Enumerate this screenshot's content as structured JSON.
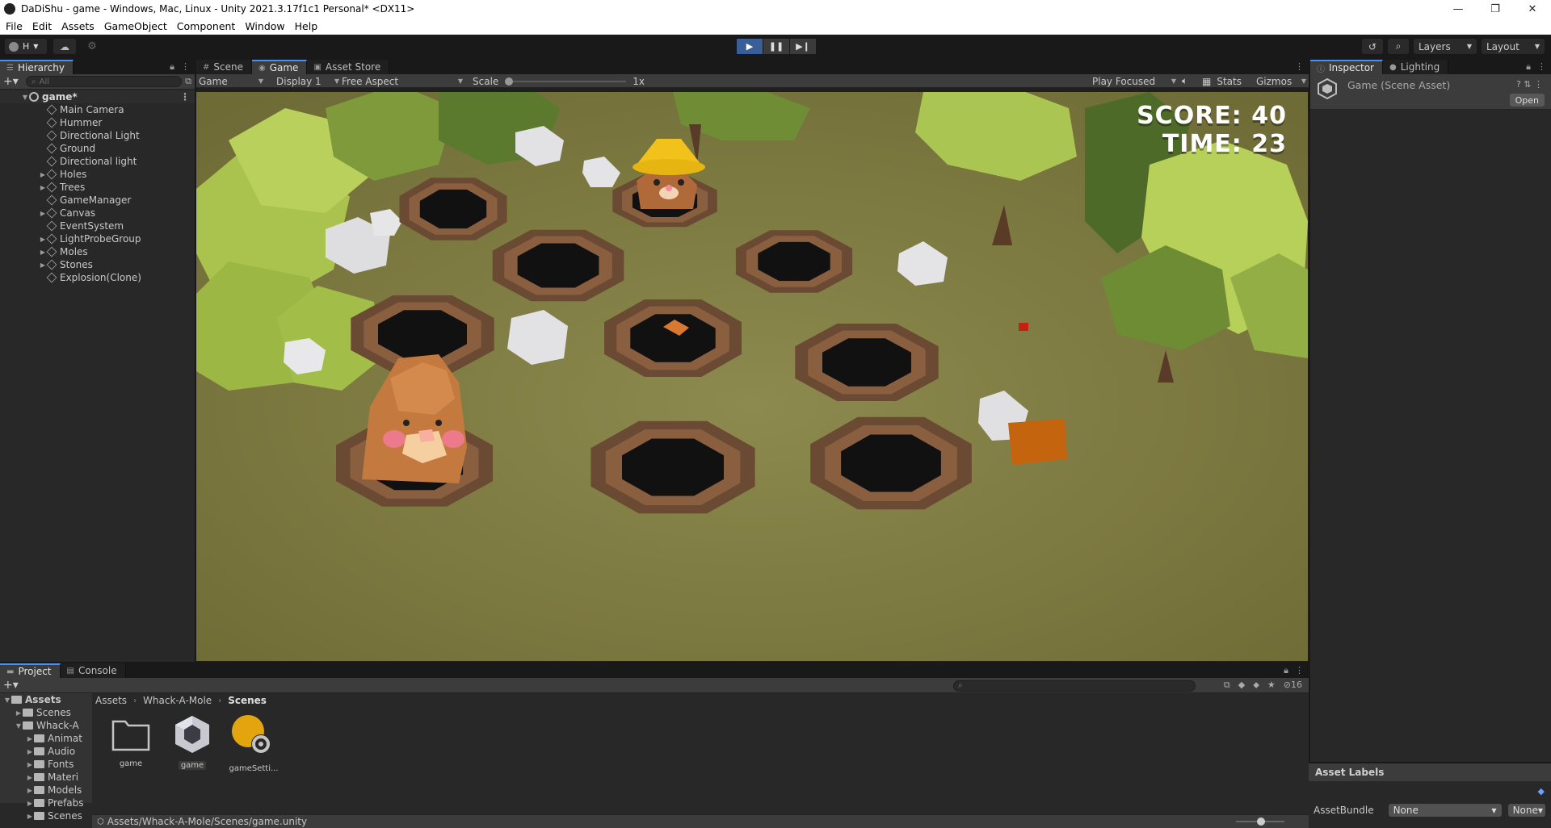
{
  "window": {
    "title": "DaDiShu - game - Windows, Mac, Linux - Unity 2021.3.17f1c1 Personal* <DX11>",
    "controls": [
      "—",
      "❐",
      "✕"
    ]
  },
  "menu": [
    "File",
    "Edit",
    "Assets",
    "GameObject",
    "Component",
    "Window",
    "Help"
  ],
  "toolbar": {
    "account_label": "H",
    "layers_label": "Layers",
    "layout_label": "Layout"
  },
  "hierarchy": {
    "tab_label": "Hierarchy",
    "search_placeholder": "All",
    "scene_name": "game*",
    "items": [
      {
        "label": "Main Camera",
        "expandable": false
      },
      {
        "label": "Hummer",
        "expandable": false
      },
      {
        "label": "Directional Light",
        "expandable": false
      },
      {
        "label": "Ground",
        "expandable": false
      },
      {
        "label": "Directional light",
        "expandable": false
      },
      {
        "label": "Holes",
        "expandable": true
      },
      {
        "label": "Trees",
        "expandable": true
      },
      {
        "label": "GameManager",
        "expandable": false
      },
      {
        "label": "Canvas",
        "expandable": true
      },
      {
        "label": "EventSystem",
        "expandable": false
      },
      {
        "label": "LightProbeGroup",
        "expandable": true
      },
      {
        "label": "Moles",
        "expandable": true
      },
      {
        "label": "Stones",
        "expandable": true
      },
      {
        "label": "Explosion(Clone)",
        "expandable": false
      }
    ]
  },
  "center_tabs": [
    {
      "label": "Scene",
      "icon": "grid-icon",
      "active": false
    },
    {
      "label": "Game",
      "icon": "gamepad-icon",
      "active": true
    },
    {
      "label": "Asset Store",
      "icon": "bag-icon",
      "active": false
    }
  ],
  "game_toolbar": {
    "view_select": "Game",
    "display_select": "Display 1",
    "aspect_select": "Free Aspect",
    "scale_label": "Scale",
    "scale_value": "1x",
    "scale_fraction": 0.0,
    "play_mode_select": "Play Focused",
    "stats_label": "Stats",
    "gizmos_label": "Gizmos"
  },
  "game_hud": {
    "score_text": "SCORE: 40",
    "time_text": "TIME: 23"
  },
  "inspector": {
    "tabs": [
      {
        "label": "Inspector",
        "icon": "info-icon",
        "active": true
      },
      {
        "label": "Lighting",
        "icon": "bulb-icon",
        "active": false
      }
    ],
    "title": "Game (Scene Asset)",
    "open_button": "Open"
  },
  "project": {
    "tabs": [
      {
        "label": "Project",
        "icon": "folder-icon",
        "active": true
      },
      {
        "label": "Console",
        "icon": "console-icon",
        "active": false
      }
    ],
    "hidden_count": "16",
    "tree": [
      {
        "label": "Assets",
        "depth": 0,
        "bold": true,
        "open": true
      },
      {
        "label": "Scenes",
        "depth": 1,
        "bold": false,
        "open": false
      },
      {
        "label": "Whack-A",
        "depth": 1,
        "bold": false,
        "open": true
      },
      {
        "label": "Animat",
        "depth": 2,
        "bold": false,
        "open": false
      },
      {
        "label": "Audio",
        "depth": 2,
        "bold": false,
        "open": false
      },
      {
        "label": "Fonts",
        "depth": 2,
        "bold": false,
        "open": false
      },
      {
        "label": "Materi",
        "depth": 2,
        "bold": false,
        "open": false
      },
      {
        "label": "Models",
        "depth": 2,
        "bold": false,
        "open": false
      },
      {
        "label": "Prefabs",
        "depth": 2,
        "bold": false,
        "open": false
      },
      {
        "label": "Scenes",
        "depth": 2,
        "bold": false,
        "open": false
      }
    ],
    "breadcrumbs": [
      "Assets",
      "Whack-A-Mole",
      "Scenes"
    ],
    "assets": [
      {
        "label": "game",
        "kind": "folder",
        "selected": false
      },
      {
        "label": "game",
        "kind": "unity-scene",
        "selected": true
      },
      {
        "label": "gameSetti...",
        "kind": "lighting-settings",
        "selected": false
      }
    ],
    "status_path": "Assets/Whack-A-Mole/Scenes/game.unity"
  },
  "asset_labels": {
    "title": "Asset Labels",
    "bundle_label": "AssetBundle",
    "bundle_value": "None",
    "variant_value": "None"
  },
  "colors": {
    "accent": "#4a8ff7",
    "play_active": "#3a5f96",
    "ground": "#7e7a40",
    "hud_text": "#ffffff"
  }
}
